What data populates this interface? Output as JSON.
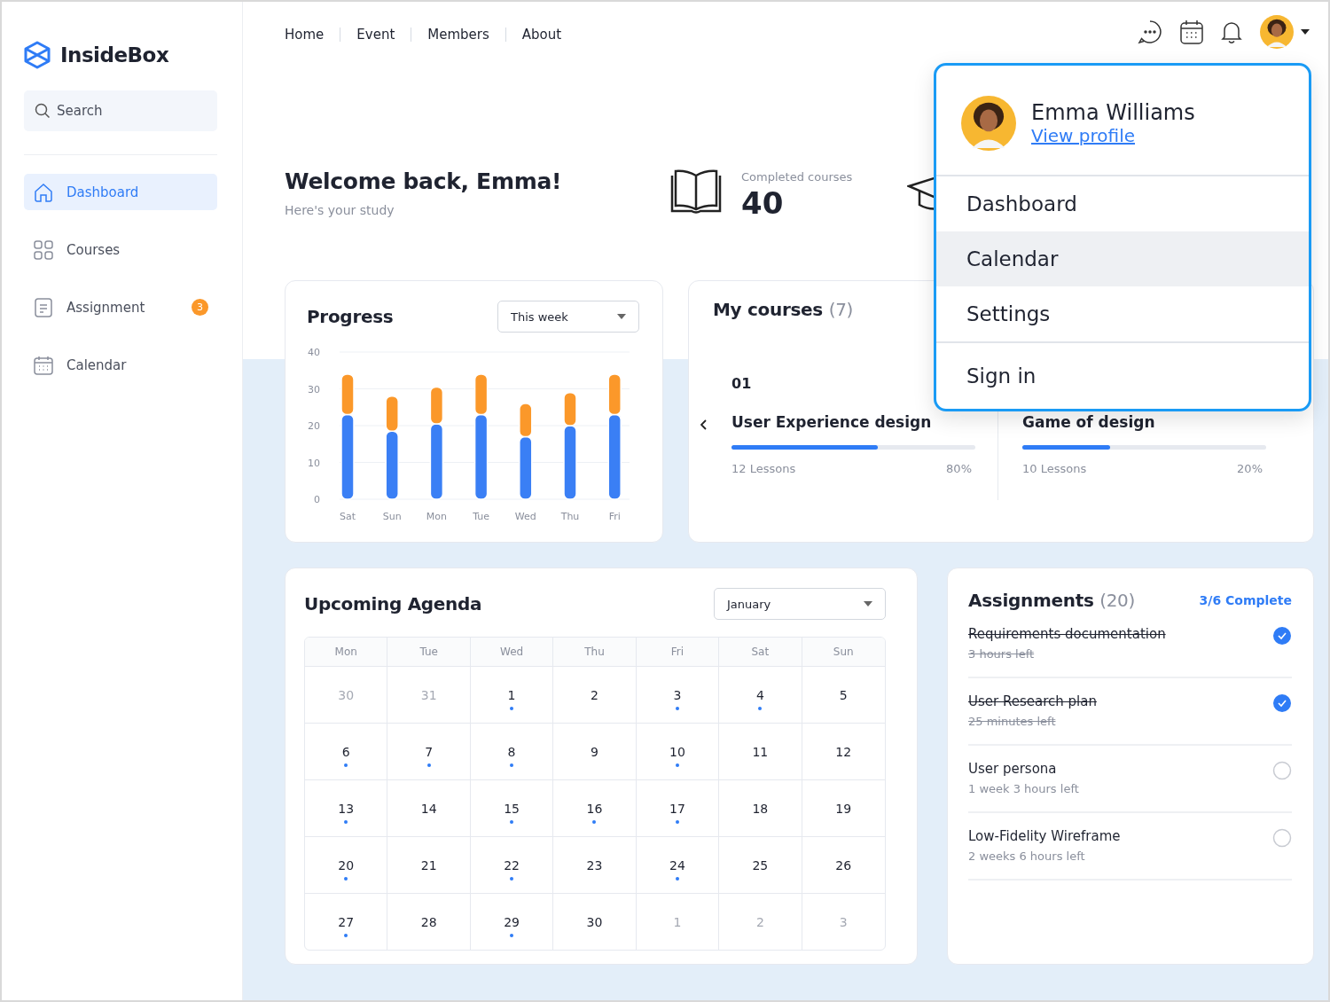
{
  "brand": {
    "name": "InsideBox"
  },
  "search": {
    "placeholder": "Search"
  },
  "sidebar": {
    "items": [
      {
        "label": "Dashboard",
        "selected": true
      },
      {
        "label": "Courses",
        "selected": false
      },
      {
        "label": "Assignment",
        "selected": false,
        "badge": "3"
      },
      {
        "label": "Calendar",
        "selected": false
      }
    ]
  },
  "top_nav": [
    "Home",
    "Event",
    "Members",
    "About"
  ],
  "welcome": {
    "title": "Welcome back, Emma!",
    "subtitle": "Here's your study"
  },
  "stat": {
    "label": "Completed courses",
    "value": "40"
  },
  "progress": {
    "title": "Progress",
    "period": "This week",
    "chart_data": {
      "type": "bar",
      "stacked": true,
      "grid": true,
      "categories": [
        "Sat",
        "Sun",
        "Mon",
        "Tue",
        "Wed",
        "Thu",
        "Fri"
      ],
      "ylim": [
        0,
        40
      ],
      "yticks": [
        0,
        10,
        20,
        30,
        40
      ],
      "series": [
        {
          "color": "#3a7ff5",
          "values": [
            23,
            18.5,
            20.5,
            23,
            17,
            20,
            23
          ]
        },
        {
          "color": "#fb982a",
          "values": [
            11,
            9.5,
            10,
            11,
            9,
            9,
            11
          ]
        }
      ]
    }
  },
  "courses": {
    "title": "My courses",
    "count": "(7)",
    "items": [
      {
        "number": "01",
        "title": "User Experience design",
        "lessons": "12 Lessons",
        "percent": "80%",
        "level": 0.6
      },
      {
        "title": "Game of design",
        "lessons": "10 Lessons",
        "percent": "20%",
        "level": 0.36
      }
    ]
  },
  "agenda": {
    "title": "Upcoming Agenda",
    "month": "January",
    "weekdays": [
      "Mon",
      "Tue",
      "Wed",
      "Thu",
      "Fri",
      "Sat",
      "Sun"
    ],
    "days": [
      {
        "day": "30",
        "muted": true,
        "event": false
      },
      {
        "day": "31",
        "muted": true,
        "event": false
      },
      {
        "day": "1",
        "muted": false,
        "event": true
      },
      {
        "day": "2",
        "muted": false,
        "event": false
      },
      {
        "day": "3",
        "muted": false,
        "event": true
      },
      {
        "day": "4",
        "muted": false,
        "event": true
      },
      {
        "day": "5",
        "muted": false,
        "event": false
      },
      {
        "day": "6",
        "muted": false,
        "event": true
      },
      {
        "day": "7",
        "muted": false,
        "event": true
      },
      {
        "day": "8",
        "muted": false,
        "event": true
      },
      {
        "day": "9",
        "muted": false,
        "event": false
      },
      {
        "day": "10",
        "muted": false,
        "event": true
      },
      {
        "day": "11",
        "muted": false,
        "event": false
      },
      {
        "day": "12",
        "muted": false,
        "event": false
      },
      {
        "day": "13",
        "muted": false,
        "event": true
      },
      {
        "day": "14",
        "muted": false,
        "event": false
      },
      {
        "day": "15",
        "muted": false,
        "event": true
      },
      {
        "day": "16",
        "muted": false,
        "event": true
      },
      {
        "day": "17",
        "muted": false,
        "event": true
      },
      {
        "day": "18",
        "muted": false,
        "event": false
      },
      {
        "day": "19",
        "muted": false,
        "event": false
      },
      {
        "day": "20",
        "muted": false,
        "event": true
      },
      {
        "day": "21",
        "muted": false,
        "event": false
      },
      {
        "day": "22",
        "muted": false,
        "event": true
      },
      {
        "day": "23",
        "muted": false,
        "event": false
      },
      {
        "day": "24",
        "muted": false,
        "event": true
      },
      {
        "day": "25",
        "muted": false,
        "event": false
      },
      {
        "day": "26",
        "muted": false,
        "event": false
      },
      {
        "day": "27",
        "muted": false,
        "event": true
      },
      {
        "day": "28",
        "muted": false,
        "event": false
      },
      {
        "day": "29",
        "muted": false,
        "event": true
      },
      {
        "day": "30",
        "muted": false,
        "event": false
      },
      {
        "day": "1",
        "muted": true,
        "event": false
      },
      {
        "day": "2",
        "muted": true,
        "event": false
      },
      {
        "day": "3",
        "muted": true,
        "event": false
      }
    ]
  },
  "assignments": {
    "title": "Assignments",
    "count": "(20)",
    "status": "3/6 Complete",
    "items": [
      {
        "title": "Requirements documentation",
        "time": "3 hours left",
        "done": true
      },
      {
        "title": "User Research plan",
        "time": "25 minutes left",
        "done": true
      },
      {
        "title": "User persona",
        "time": "1 week 3 hours left",
        "done": false
      },
      {
        "title": "Low-Fidelity Wireframe",
        "time": "2 weeks 6 hours left",
        "done": false
      }
    ]
  },
  "user_menu": {
    "name": "Emma Williams",
    "link": "View profile",
    "sections": [
      {
        "items": [
          {
            "label": "Dashboard",
            "selected": false
          },
          {
            "label": "Calendar",
            "selected": true
          },
          {
            "label": "Settings",
            "selected": false
          }
        ]
      },
      {
        "items": [
          {
            "label": "Sign in",
            "selected": false
          }
        ]
      }
    ]
  }
}
